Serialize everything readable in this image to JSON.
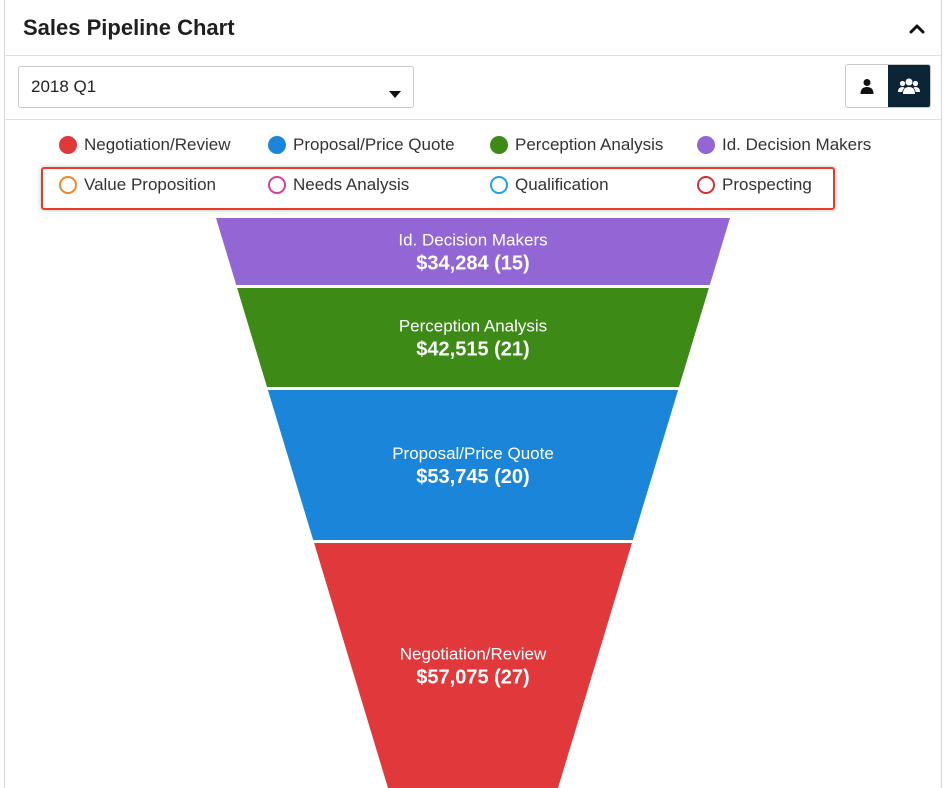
{
  "header": {
    "title": "Sales Pipeline Chart",
    "collapse_icon": "chevron-up-icon"
  },
  "toolbar": {
    "period_value": "2018 Q1",
    "view_buttons": [
      {
        "icon": "user-icon",
        "active": false
      },
      {
        "icon": "group-icon",
        "active": true
      }
    ]
  },
  "legend": {
    "items": [
      {
        "label": "Negotiation/Review",
        "color": "#e0383b",
        "filled": true
      },
      {
        "label": "Proposal/Price Quote",
        "color": "#1b86d9",
        "filled": true
      },
      {
        "label": "Perception Analysis",
        "color": "#3d8b16",
        "filled": true
      },
      {
        "label": "Id. Decision Makers",
        "color": "#9366d6",
        "filled": true
      },
      {
        "label": "Value Proposition",
        "color": "#f0862b",
        "filled": false
      },
      {
        "label": "Needs Analysis",
        "color": "#d43f9e",
        "filled": false
      },
      {
        "label": "Qualification",
        "color": "#1fa1e8",
        "filled": false
      },
      {
        "label": "Prospecting",
        "color": "#d32f2f",
        "filled": false
      }
    ]
  },
  "chart_data": {
    "type": "funnel",
    "segments": [
      {
        "name": "Id. Decision Makers",
        "label": "$34,284 (15)",
        "amount": 34284,
        "count": 15,
        "color": "#9366d6"
      },
      {
        "name": "Perception Analysis",
        "label": "$42,515 (21)",
        "amount": 42515,
        "count": 21,
        "color": "#3d8b16"
      },
      {
        "name": "Proposal/Price Quote",
        "label": "$53,745 (20)",
        "amount": 53745,
        "count": 20,
        "color": "#1b86d9"
      },
      {
        "name": "Negotiation/Review",
        "label": "$57,075 (27)",
        "amount": 57075,
        "count": 27,
        "color": "#e0383b"
      }
    ]
  }
}
